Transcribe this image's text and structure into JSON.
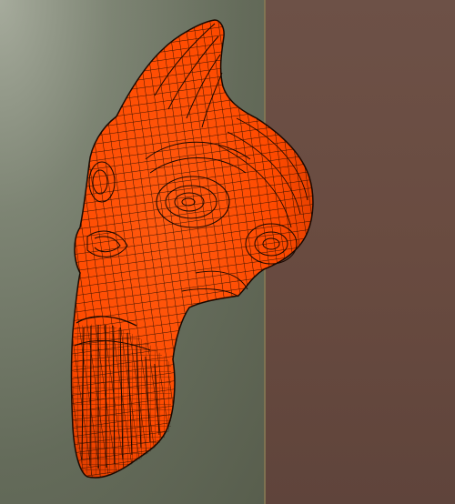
{
  "viewport": {
    "background_left": "#646b5a",
    "background_right": "#694b40",
    "divider_color": "#8f7a52"
  },
  "model": {
    "name": "skull-mesh",
    "fill_color": "#ff4a00",
    "wire_color": "#1a0800",
    "display_mode": "wireframe-on-shaded"
  }
}
